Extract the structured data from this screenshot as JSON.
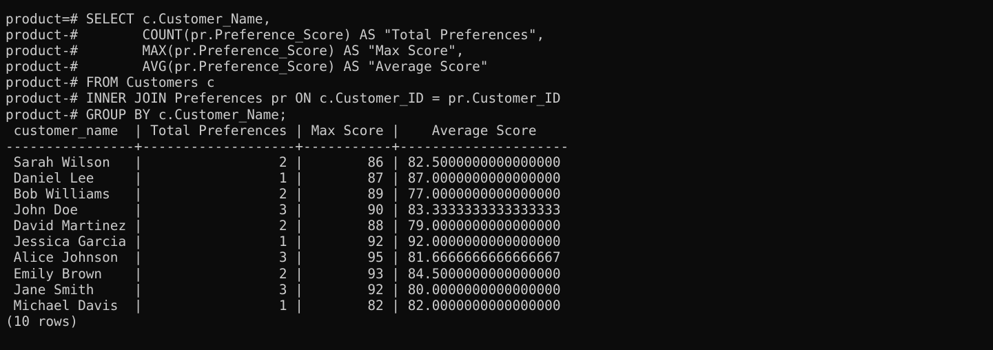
{
  "terminal": {
    "prompt_first": "product=# ",
    "prompt_cont": "product-# ",
    "query_lines": [
      "SELECT c.Customer_Name,",
      "       COUNT(pr.Preference_Score) AS \"Total Preferences\",",
      "       MAX(pr.Preference_Score) AS \"Max Score\",",
      "       AVG(pr.Preference_Score) AS \"Average Score\"",
      "FROM Customers c",
      "INNER JOIN Preferences pr ON c.Customer_ID = pr.Customer_ID",
      "GROUP BY c.Customer_Name;"
    ],
    "result": {
      "header": " customer_name  | Total Preferences | Max Score |    Average Score",
      "separator": "----------------+-------------------+-----------+---------------------",
      "rows": [
        " Sarah Wilson   |                 2 |        86 | 82.5000000000000000",
        " Daniel Lee     |                 1 |        87 | 87.0000000000000000",
        " Bob Williams   |                 2 |        89 | 77.0000000000000000",
        " John Doe       |                 3 |        90 | 83.3333333333333333",
        " David Martinez |                 2 |        88 | 79.0000000000000000",
        " Jessica Garcia |                 1 |        92 | 92.0000000000000000",
        " Alice Johnson  |                 3 |        95 | 81.6666666666666667",
        " Emily Brown    |                 2 |        93 | 84.5000000000000000",
        " Jane Smith     |                 3 |        92 | 80.0000000000000000",
        " Michael Davis  |                 1 |        82 | 82.0000000000000000"
      ],
      "footer": "(10 rows)"
    },
    "colors": {
      "background": "#0c0c0c",
      "text": "#cccccc"
    }
  }
}
